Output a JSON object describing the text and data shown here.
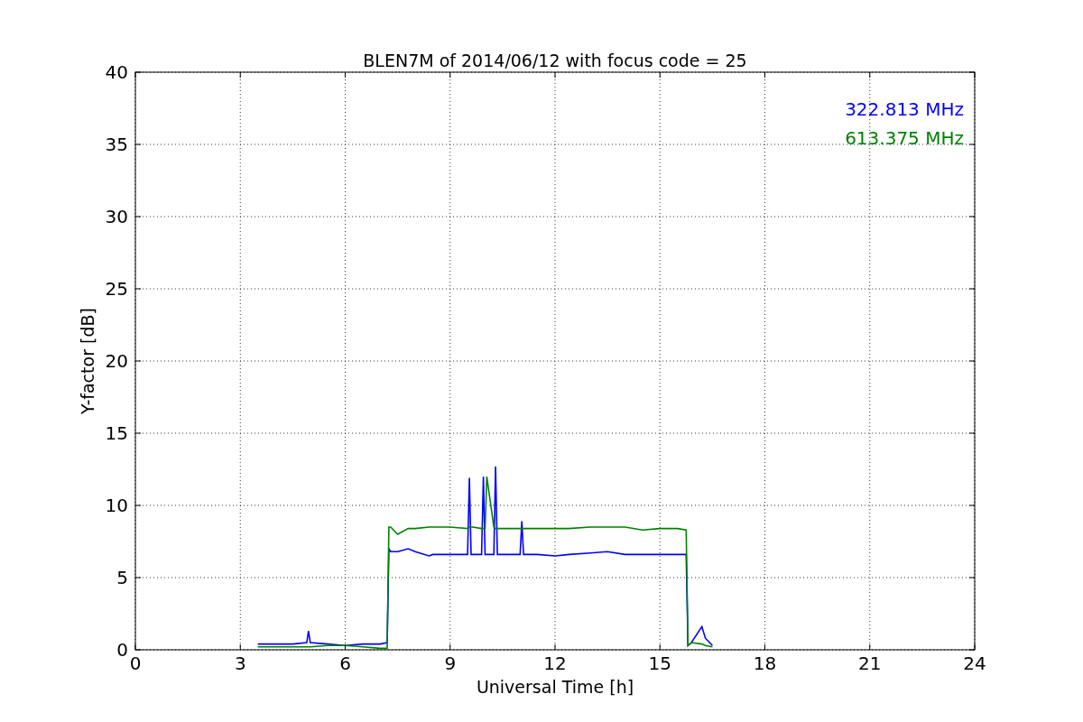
{
  "figure": {
    "chart_data": {
      "type": "line",
      "title": "BLEN7M of 2014/06/12 with focus code = 25",
      "xlabel": "Universal Time [h]",
      "ylabel": "Y-factor [dB]",
      "x": [
        3.5,
        4,
        4.5,
        4.9,
        4.95,
        5,
        5.5,
        6,
        6.5,
        7,
        7.2,
        7.25,
        7.3,
        7.5,
        7.8,
        8,
        8.4,
        8.5,
        9,
        9.5,
        9.55,
        9.6,
        9.65,
        9.9,
        9.95,
        10,
        10.05,
        10.25,
        10.3,
        10.35,
        11,
        11.05,
        11.1,
        11.5,
        12,
        12.4,
        13,
        13.5,
        14,
        14.5,
        15,
        15.5,
        15.75,
        15.8,
        15.9,
        16.2,
        16.3,
        16.5
      ],
      "series": [
        {
          "name": "322.813 MHz",
          "color": "#0000ff",
          "values": [
            0.4,
            0.4,
            0.4,
            0.5,
            1.3,
            0.5,
            0.4,
            0.3,
            0.4,
            0.4,
            0.5,
            7.0,
            6.8,
            6.8,
            7.0,
            6.8,
            6.5,
            6.6,
            6.6,
            6.6,
            11.9,
            6.6,
            6.6,
            6.6,
            12.0,
            6.6,
            6.6,
            6.6,
            12.7,
            6.6,
            6.6,
            8.9,
            6.6,
            6.6,
            6.5,
            6.6,
            6.7,
            6.8,
            6.6,
            6.6,
            6.6,
            6.6,
            6.6,
            0.3,
            0.5,
            1.6,
            0.8,
            0.3
          ]
        },
        {
          "name": "613.375 MHz",
          "color": "#008000",
          "values": [
            0.2,
            0.2,
            0.2,
            0.2,
            0.2,
            0.2,
            0.3,
            0.3,
            0.2,
            0.1,
            0.1,
            8.5,
            8.5,
            8.0,
            8.4,
            8.4,
            8.5,
            8.5,
            8.5,
            8.4,
            8.5,
            8.5,
            8.5,
            8.4,
            8.4,
            8.4,
            12.0,
            8.5,
            8.4,
            8.4,
            8.4,
            8.4,
            8.4,
            8.4,
            8.4,
            8.4,
            8.5,
            8.5,
            8.5,
            8.3,
            8.4,
            8.4,
            8.3,
            0.3,
            0.5,
            0.4,
            0.3,
            0.2
          ]
        }
      ],
      "grid": true,
      "xlim": [
        0,
        24
      ],
      "ylim": [
        0,
        40
      ],
      "xticks": [
        0,
        3,
        6,
        9,
        12,
        15,
        18,
        21,
        24
      ],
      "yticks": [
        0,
        5,
        10,
        15,
        20,
        25,
        30,
        35,
        40
      ]
    }
  }
}
